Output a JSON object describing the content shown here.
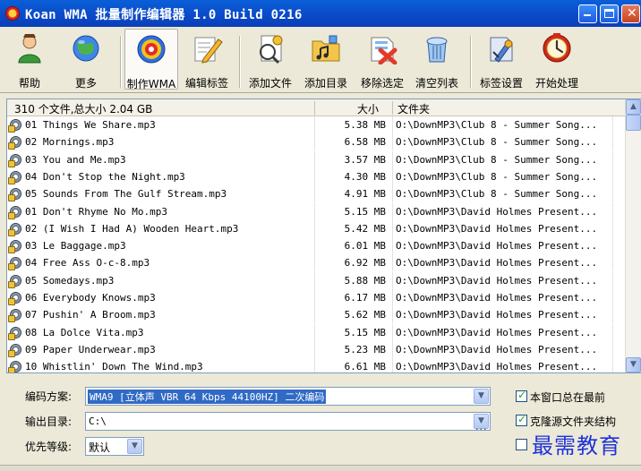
{
  "window": {
    "title": "Koan WMA 批量制作编辑器 1.0 Build 0216"
  },
  "toolbar": {
    "buttons": [
      {
        "label": "帮助",
        "icon": "help-person-icon"
      },
      {
        "label": "更多",
        "icon": "globe-icon"
      },
      {
        "label": "制作WMA",
        "icon": "wma-target-icon",
        "active": true
      },
      {
        "label": "编辑标签",
        "icon": "edit-pencil-icon"
      },
      {
        "label": "添加文件",
        "icon": "add-file-icon"
      },
      {
        "label": "添加目录",
        "icon": "add-folder-icon"
      },
      {
        "label": "移除选定",
        "icon": "remove-selected-icon"
      },
      {
        "label": "清空列表",
        "icon": "clear-list-icon"
      },
      {
        "label": "标签设置",
        "icon": "tag-settings-icon"
      },
      {
        "label": "开始处理",
        "icon": "start-process-icon"
      }
    ]
  },
  "filelist": {
    "summary": "310 个文件,总大小 2.04 GB",
    "col_size": "大小",
    "col_folder": "文件夹",
    "rows": [
      {
        "name": "01 Things We Share.mp3",
        "size": "5.38 MB",
        "folder": "O:\\DownMP3\\Club 8 - Summer Song..."
      },
      {
        "name": "02 Mornings.mp3",
        "size": "6.58 MB",
        "folder": "O:\\DownMP3\\Club 8 - Summer Song..."
      },
      {
        "name": "03 You and Me.mp3",
        "size": "3.57 MB",
        "folder": "O:\\DownMP3\\Club 8 - Summer Song..."
      },
      {
        "name": "04 Don't Stop the Night.mp3",
        "size": "4.30 MB",
        "folder": "O:\\DownMP3\\Club 8 - Summer Song..."
      },
      {
        "name": "05 Sounds From The Gulf Stream.mp3",
        "size": "4.91 MB",
        "folder": "O:\\DownMP3\\Club 8 - Summer Song..."
      },
      {
        "name": "01 Don't Rhyme No Mo.mp3",
        "size": "5.15 MB",
        "folder": "O:\\DownMP3\\David Holmes Present..."
      },
      {
        "name": "02 (I Wish I Had A) Wooden Heart.mp3",
        "size": "5.42 MB",
        "folder": "O:\\DownMP3\\David Holmes Present..."
      },
      {
        "name": "03 Le Baggage.mp3",
        "size": "6.01 MB",
        "folder": "O:\\DownMP3\\David Holmes Present..."
      },
      {
        "name": "04 Free Ass O-c-8.mp3",
        "size": "6.92 MB",
        "folder": "O:\\DownMP3\\David Holmes Present..."
      },
      {
        "name": "05 Somedays.mp3",
        "size": "5.88 MB",
        "folder": "O:\\DownMP3\\David Holmes Present..."
      },
      {
        "name": "06 Everybody Knows.mp3",
        "size": "6.17 MB",
        "folder": "O:\\DownMP3\\David Holmes Present..."
      },
      {
        "name": "07 Pushin' A Broom.mp3",
        "size": "5.62 MB",
        "folder": "O:\\DownMP3\\David Holmes Present..."
      },
      {
        "name": "08 La Dolce Vita.mp3",
        "size": "5.15 MB",
        "folder": "O:\\DownMP3\\David Holmes Present..."
      },
      {
        "name": "09 Paper Underwear.mp3",
        "size": "5.23 MB",
        "folder": "O:\\DownMP3\\David Holmes Present..."
      },
      {
        "name": "10 Whistlin' Down The Wind.mp3",
        "size": "6.61 MB",
        "folder": "O:\\DownMP3\\David Holmes Present..."
      }
    ]
  },
  "settings": {
    "encoding_label": "编码方案:",
    "encoding_value": "WMA9 [立体声 VBR  64 Kbps 44100HZ] 二次编码",
    "output_label": "输出目录:",
    "output_value": "C:\\",
    "output_browse": "...",
    "priority_label": "优先等级:",
    "priority_value": "默认",
    "always_on_top": {
      "label": "本窗口总在最前",
      "checked": true
    },
    "clone_structure": {
      "label": "克隆源文件夹结构",
      "checked": true
    },
    "third_option": {
      "checked": false
    }
  },
  "watermark": "最需教育"
}
